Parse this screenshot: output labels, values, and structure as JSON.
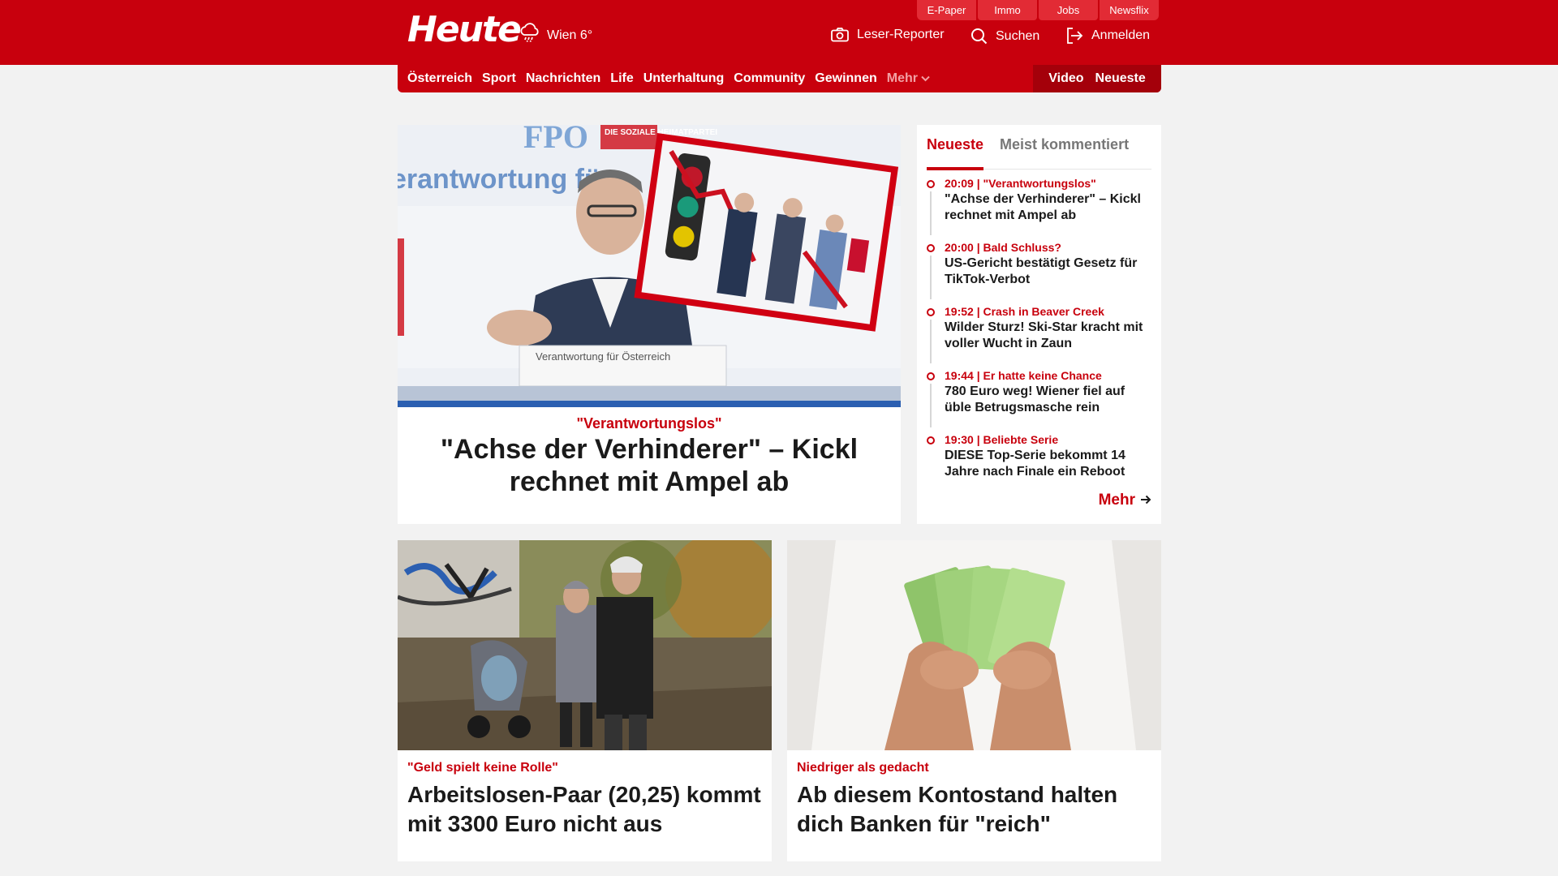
{
  "header": {
    "logo": "Heute",
    "weather": "Wien 6°",
    "top_links": [
      "E-Paper",
      "Immo",
      "Jobs",
      "Newsflix"
    ],
    "leser_reporter": "Leser-Reporter",
    "search": "Suchen",
    "login": "Anmelden"
  },
  "nav": {
    "items": [
      "Österreich",
      "Sport",
      "Nachrichten",
      "Life",
      "Unterhaltung",
      "Community",
      "Gewinnen"
    ],
    "more": "Mehr",
    "video": "Video",
    "latest": "Neueste"
  },
  "hero": {
    "kicker": "\"Verantwortungslos\"",
    "title": "\"Achse der Verhinderer\" – Kickl rechnet mit Ampel ab",
    "image_text_banner": "erantwortung für",
    "image_text_logo": "FPÖ",
    "image_text_logo_sub": "DIE SOZIALE HEIMATPARTEI",
    "image_text_lectern": "Verantwortung für Österreich"
  },
  "sidebar": {
    "tabs": [
      "Neueste",
      "Meist kommentiert"
    ],
    "items": [
      {
        "meta": "20:09 | \"Verantwortungslos\"",
        "title": "\"Achse der Verhinderer\" – Kickl rechnet mit Ampel ab"
      },
      {
        "meta": "20:00 | Bald Schluss?",
        "title": "US-Gericht bestätigt Gesetz für TikTok-Verbot"
      },
      {
        "meta": "19:52 | Crash in Beaver Creek",
        "title": "Wilder Sturz! Ski-Star kracht mit voller Wucht in Zaun"
      },
      {
        "meta": "19:44 | Er hatte keine Chance",
        "title": "780 Euro weg! Wiener fiel auf üble Betrugsmasche rein"
      },
      {
        "meta": "19:30 | Beliebte Serie",
        "title": "DIESE Top-Serie bekommt 14 Jahre nach Finale ein Reboot"
      }
    ],
    "more": "Mehr"
  },
  "cards": [
    {
      "kicker": "\"Geld spielt keine Rolle\"",
      "title": "Arbeitslosen-Paar (20,25) kommt mit 3300 Euro nicht aus"
    },
    {
      "kicker": "Niedriger als gedacht",
      "title": "Ab diesem Kontostand halten dich Banken für \"reich\""
    }
  ],
  "colors": {
    "brand_red": "#c8000d",
    "nav_dark_red": "#a4000a",
    "top_link_red": "#e22b35",
    "background": "#f2f2f2"
  }
}
